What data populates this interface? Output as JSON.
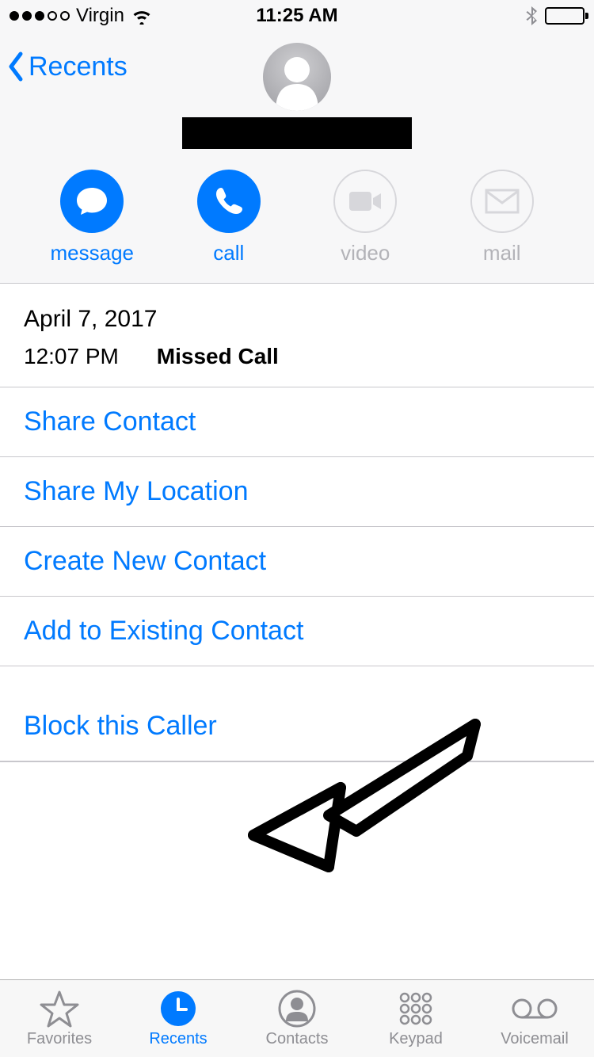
{
  "status": {
    "carrier": "Virgin",
    "time": "11:25 AM"
  },
  "nav": {
    "back_label": "Recents"
  },
  "actions": {
    "message": "message",
    "call": "call",
    "video": "video",
    "mail": "mail"
  },
  "call_log": {
    "date": "April 7, 2017",
    "time": "12:07 PM",
    "type": "Missed Call"
  },
  "menu": {
    "share_contact": "Share Contact",
    "share_location": "Share My Location",
    "create_contact": "Create New Contact",
    "add_existing": "Add to Existing Contact",
    "block": "Block this Caller"
  },
  "tabs": {
    "favorites": "Favorites",
    "recents": "Recents",
    "contacts": "Contacts",
    "keypad": "Keypad",
    "voicemail": "Voicemail"
  }
}
